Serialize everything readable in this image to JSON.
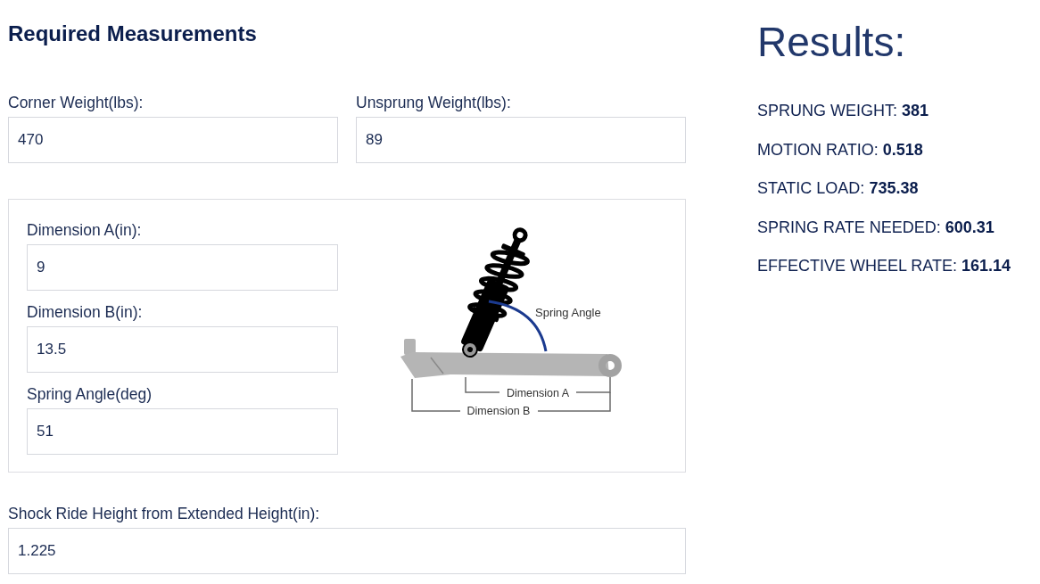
{
  "heading": "Required Measurements",
  "top_fields": [
    {
      "label": "Corner Weight(lbs):",
      "value": "470"
    },
    {
      "label": "Unsprung Weight(lbs):",
      "value": "89"
    }
  ],
  "geometry_panel": {
    "fields": [
      {
        "label": "Dimension A(in):",
        "value": "9"
      },
      {
        "label": "Dimension B(in):",
        "value": "13.5"
      },
      {
        "label": "Spring Angle(deg)",
        "value": "51"
      }
    ],
    "diagram": {
      "spring_angle_label": "Spring Angle",
      "dimension_a_label": "Dimension A",
      "dimension_b_label": "Dimension B"
    }
  },
  "bottom_field": {
    "label": "Shock Ride Height from Extended Height(in):",
    "value": "1.225"
  },
  "results": {
    "title": "Results:",
    "items": [
      {
        "label": "SPRUNG WEIGHT:",
        "value": "381"
      },
      {
        "label": "MOTION RATIO:",
        "value": "0.518"
      },
      {
        "label": "STATIC LOAD:",
        "value": "735.38"
      },
      {
        "label": "SPRING RATE NEEDED:",
        "value": "600.31"
      },
      {
        "label": "EFFECTIVE WHEEL RATE:",
        "value": "161.14"
      }
    ]
  }
}
